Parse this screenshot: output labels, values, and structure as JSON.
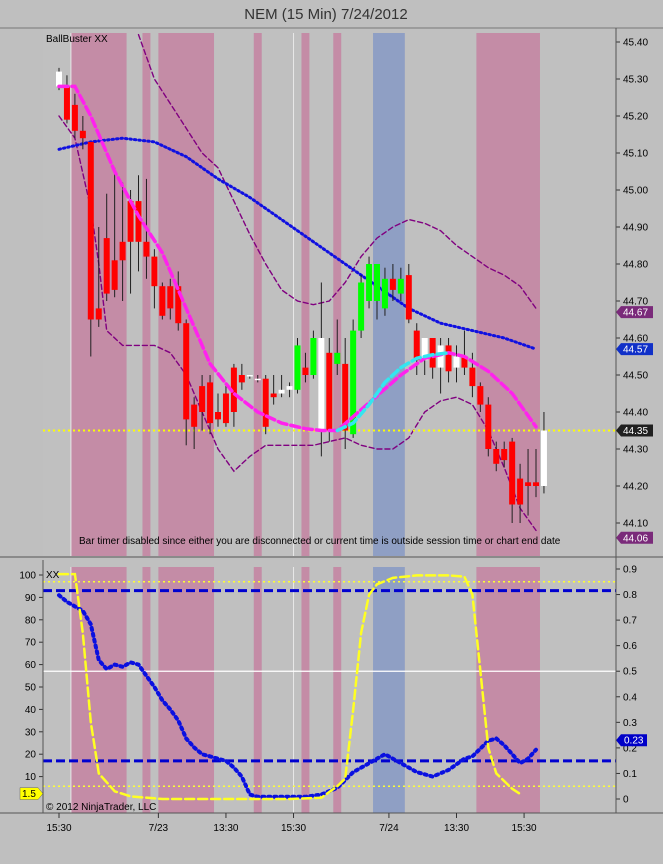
{
  "chart_title": "NEM (15 Min)  7/24/2012",
  "price_panel": {
    "indicator_label": "BallBuster XX",
    "message": "Bar timer disabled since either you are disconnected or current time is outside session time or chart end date",
    "yticks": [
      45.4,
      45.3,
      45.2,
      45.1,
      45.0,
      44.9,
      44.8,
      44.7,
      44.6,
      44.5,
      44.4,
      44.3,
      44.2,
      44.1
    ],
    "ytick_labels": [
      "45.40",
      "45.30",
      "45.20",
      "45.10",
      "45.00",
      "44.90",
      "44.80",
      "44.70",
      "44.60",
      "44.50",
      "44.40",
      "44.30",
      "44.20",
      "44.10"
    ],
    "ylim": [
      44.05,
      45.42
    ],
    "price_markers": [
      {
        "label": "44.67",
        "value": 44.67,
        "color": "#7a2a7a"
      },
      {
        "label": "44.57",
        "value": 44.57,
        "color": "#1030c8"
      },
      {
        "label": "44.35",
        "value": 44.35,
        "color": "#202020"
      },
      {
        "label": "44.06",
        "value": 44.06,
        "color": "#7a2a7a"
      }
    ],
    "yellow_line": 44.35
  },
  "oscillator_panel": {
    "indicator_label": "XX",
    "left_ticks": [
      100,
      90,
      80,
      70,
      60,
      50,
      40,
      30,
      20,
      10
    ],
    "left_tick_labels": [
      "100",
      "90",
      "80",
      "70",
      "60",
      "50",
      "40",
      "30",
      "20",
      "10"
    ],
    "right_ticks": [
      0.9,
      0.8,
      0.7,
      0.6,
      0.5,
      0.4,
      0.3,
      0.2,
      0.1,
      0
    ],
    "right_tick_labels": [
      "0.9",
      "0.8",
      "0.7",
      "0.6",
      "0.5",
      "0.4",
      "0.3",
      "0.2",
      "0.1",
      "0"
    ],
    "left_marker": "1.5",
    "right_marker": "0.23",
    "copyright": "© 2012 NinjaTrader, LLC"
  },
  "x_axis_labels": [
    {
      "label": "15:30",
      "bar": 1
    },
    {
      "label": "7/23",
      "bar": 13.5
    },
    {
      "label": "13:30",
      "bar": 22
    },
    {
      "label": "15:30",
      "bar": 30.5
    },
    {
      "label": "7/24",
      "bar": 42.5
    },
    {
      "label": "13:30",
      "bar": 51
    },
    {
      "label": "15:30",
      "bar": 59.5
    }
  ],
  "chart_data": {
    "type": "candlestick",
    "bars": [
      {
        "o": 45.32,
        "h": 45.33,
        "l": 45.27,
        "c": 45.28
      },
      {
        "o": 45.28,
        "h": 45.31,
        "l": 45.18,
        "c": 45.19
      },
      {
        "o": 45.23,
        "h": 45.26,
        "l": 45.14,
        "c": 45.16
      },
      {
        "o": 45.16,
        "h": 45.2,
        "l": 45.11,
        "c": 45.14
      },
      {
        "o": 45.13,
        "h": 44.95,
        "l": 44.55,
        "c": 44.65
      },
      {
        "o": 44.65,
        "h": 44.9,
        "l": 44.63,
        "c": 44.68
      },
      {
        "o": 44.87,
        "h": 44.99,
        "l": 44.7,
        "c": 44.72
      },
      {
        "o": 44.73,
        "h": 45.06,
        "l": 44.71,
        "c": 44.81
      },
      {
        "o": 44.81,
        "h": 45.02,
        "l": 44.7,
        "c": 44.86
      },
      {
        "o": 44.86,
        "h": 45.0,
        "l": 44.72,
        "c": 44.97
      },
      {
        "o": 44.97,
        "h": 45.04,
        "l": 44.78,
        "c": 44.86
      },
      {
        "o": 44.86,
        "h": 45.03,
        "l": 44.76,
        "c": 44.82
      },
      {
        "o": 44.82,
        "h": 44.84,
        "l": 44.68,
        "c": 44.74
      },
      {
        "o": 44.74,
        "h": 44.75,
        "l": 44.65,
        "c": 44.66
      },
      {
        "o": 44.74,
        "h": 44.76,
        "l": 44.65,
        "c": 44.68
      },
      {
        "o": 44.74,
        "h": 44.78,
        "l": 44.62,
        "c": 44.64
      },
      {
        "o": 44.64,
        "h": 44.65,
        "l": 44.31,
        "c": 44.38
      },
      {
        "o": 44.42,
        "h": 44.44,
        "l": 44.3,
        "c": 44.36
      },
      {
        "o": 44.47,
        "h": 44.5,
        "l": 44.35,
        "c": 44.4
      },
      {
        "o": 44.48,
        "h": 44.5,
        "l": 44.34,
        "c": 44.37
      },
      {
        "o": 44.4,
        "h": 44.45,
        "l": 44.36,
        "c": 44.38
      },
      {
        "o": 44.45,
        "h": 44.48,
        "l": 44.36,
        "c": 44.37
      },
      {
        "o": 44.52,
        "h": 44.53,
        "l": 44.36,
        "c": 44.4
      },
      {
        "o": 44.5,
        "h": 44.53,
        "l": 44.46,
        "c": 44.48
      },
      {
        "o": 44.5,
        "h": 44.5,
        "l": 44.49,
        "c": 44.5
      },
      {
        "o": 44.49,
        "h": 44.5,
        "l": 44.48,
        "c": 44.49
      },
      {
        "o": 44.49,
        "h": 44.5,
        "l": 44.34,
        "c": 44.36
      },
      {
        "o": 44.45,
        "h": 44.5,
        "l": 44.42,
        "c": 44.44
      },
      {
        "o": 44.46,
        "h": 44.5,
        "l": 44.44,
        "c": 44.45
      },
      {
        "o": 44.46,
        "h": 44.48,
        "l": 44.44,
        "c": 44.47
      },
      {
        "o": 44.46,
        "h": 44.6,
        "l": 44.45,
        "c": 44.58
      },
      {
        "o": 44.52,
        "h": 44.56,
        "l": 44.48,
        "c": 44.5
      },
      {
        "o": 44.5,
        "h": 44.62,
        "l": 44.49,
        "c": 44.6
      },
      {
        "o": 44.6,
        "h": 44.75,
        "l": 44.28,
        "c": 44.35
      },
      {
        "o": 44.35,
        "h": 44.6,
        "l": 44.32,
        "c": 44.56
      },
      {
        "o": 44.56,
        "h": 44.65,
        "l": 44.5,
        "c": 44.53
      },
      {
        "o": 44.53,
        "h": 44.6,
        "l": 44.3,
        "c": 44.35
      },
      {
        "o": 44.34,
        "h": 44.65,
        "l": 44.33,
        "c": 44.62
      },
      {
        "o": 44.62,
        "h": 44.77,
        "l": 44.6,
        "c": 44.75
      },
      {
        "o": 44.7,
        "h": 44.82,
        "l": 44.68,
        "c": 44.8
      },
      {
        "o": 44.8,
        "h": 44.8,
        "l": 44.65,
        "c": 44.7
      },
      {
        "o": 44.68,
        "h": 44.79,
        "l": 44.66,
        "c": 44.76
      },
      {
        "o": 44.73,
        "h": 44.8,
        "l": 44.7,
        "c": 44.76
      },
      {
        "o": 44.76,
        "h": 44.79,
        "l": 44.7,
        "c": 44.72
      },
      {
        "o": 44.77,
        "h": 44.8,
        "l": 44.64,
        "c": 44.65
      },
      {
        "o": 44.62,
        "h": 44.64,
        "l": 44.5,
        "c": 44.54
      },
      {
        "o": 44.54,
        "h": 44.6,
        "l": 44.5,
        "c": 44.6
      },
      {
        "o": 44.6,
        "h": 44.6,
        "l": 44.49,
        "c": 44.52
      },
      {
        "o": 44.52,
        "h": 44.6,
        "l": 44.45,
        "c": 44.58
      },
      {
        "o": 44.58,
        "h": 44.6,
        "l": 44.48,
        "c": 44.51
      },
      {
        "o": 44.52,
        "h": 44.58,
        "l": 44.48,
        "c": 44.55
      },
      {
        "o": 44.55,
        "h": 44.62,
        "l": 44.5,
        "c": 44.52
      },
      {
        "o": 44.52,
        "h": 44.56,
        "l": 44.44,
        "c": 44.47
      },
      {
        "o": 44.47,
        "h": 44.48,
        "l": 44.4,
        "c": 44.42
      },
      {
        "o": 44.42,
        "h": 44.44,
        "l": 44.28,
        "c": 44.3
      },
      {
        "o": 44.3,
        "h": 44.32,
        "l": 44.24,
        "c": 44.26
      },
      {
        "o": 44.3,
        "h": 44.32,
        "l": 44.25,
        "c": 44.27
      },
      {
        "o": 44.32,
        "h": 44.33,
        "l": 44.1,
        "c": 44.15
      },
      {
        "o": 44.22,
        "h": 44.26,
        "l": 44.1,
        "c": 44.15
      },
      {
        "o": 44.2,
        "h": 44.3,
        "l": 44.12,
        "c": 44.21
      },
      {
        "o": 44.21,
        "h": 44.3,
        "l": 44.17,
        "c": 44.2
      },
      {
        "o": 44.2,
        "h": 44.4,
        "l": 44.18,
        "c": 44.35
      }
    ],
    "bar_colors": [
      "#ffffff",
      "#ff0000",
      "#ff0000",
      "#ff0000",
      "#ff0000",
      "#ff0000",
      "#ff0000",
      "#ff0000",
      "#ff0000",
      "#ff0000",
      "#ff0000",
      "#ff0000",
      "#ff0000",
      "#ff0000",
      "#ff0000",
      "#ff0000",
      "#ff0000",
      "#ff0000",
      "#ff0000",
      "#ff0000",
      "#ff0000",
      "#ff0000",
      "#ff0000",
      "#ff0000",
      "#ffffff",
      "#ffffff",
      "#ff0000",
      "#ff0000",
      "#ffffff",
      "#ffffff",
      "#00ff00",
      "#ff0000",
      "#00ff00",
      "#ffffff",
      "#ff0000",
      "#00ff00",
      "#ff0000",
      "#00ff00",
      "#00ff00",
      "#00ff00",
      "#00ff00",
      "#00ff00",
      "#ff0000",
      "#00ff00",
      "#ff0000",
      "#ff0000",
      "#ffffff",
      "#ff0000",
      "#ffffff",
      "#ff0000",
      "#ffffff",
      "#ff0000",
      "#ff0000",
      "#ff0000",
      "#ff0000",
      "#ff0000",
      "#ff0000",
      "#ff0000",
      "#ff0000",
      "#ff0000",
      "#ff0000",
      "#ffffff"
    ],
    "session_bands": [
      {
        "start": 2.5,
        "end": 9.5,
        "color": "#c48ca6"
      },
      {
        "start": 11.5,
        "end": 12.5,
        "color": "#c48ca6"
      },
      {
        "start": 13.5,
        "end": 20.5,
        "color": "#c48ca6"
      },
      {
        "start": 25.5,
        "end": 26.5,
        "color": "#c48ca6"
      },
      {
        "start": 31.5,
        "end": 32.5,
        "color": "#c48ca6"
      },
      {
        "start": 35.5,
        "end": 36.5,
        "color": "#c48ca6"
      },
      {
        "start": 40.5,
        "end": 44.5,
        "color": "#8f9fc4"
      },
      {
        "start": 53.5,
        "end": 61.5,
        "color": "#c48ca6"
      }
    ],
    "session_divider_bars": [
      2.5,
      30.5
    ],
    "magenta_ma": [
      [
        1,
        45.28
      ],
      [
        3,
        45.28
      ],
      [
        5,
        45.2
      ],
      [
        8,
        45.05
      ],
      [
        11,
        44.93
      ],
      [
        14,
        44.83
      ],
      [
        17,
        44.68
      ],
      [
        20,
        44.53
      ],
      [
        23,
        44.45
      ],
      [
        26,
        44.4
      ],
      [
        29,
        44.37
      ],
      [
        32,
        44.355
      ],
      [
        34,
        44.35
      ],
      [
        36,
        44.35
      ],
      [
        44,
        44.5
      ],
      [
        47,
        44.545
      ],
      [
        50,
        44.56
      ],
      [
        52,
        44.55
      ],
      [
        55,
        44.51
      ],
      [
        58,
        44.45
      ],
      [
        61,
        44.36
      ]
    ],
    "cyan_ma": [
      [
        36,
        44.35
      ],
      [
        38,
        44.37
      ],
      [
        40,
        44.42
      ],
      [
        42,
        44.48
      ],
      [
        44,
        44.52
      ],
      [
        46,
        44.545
      ],
      [
        48,
        44.555
      ],
      [
        50,
        44.56
      ]
    ],
    "blue_ma": [
      [
        1,
        45.11
      ],
      [
        5,
        45.13
      ],
      [
        9,
        45.14
      ],
      [
        13,
        45.13
      ],
      [
        17,
        45.09
      ],
      [
        21,
        45.03
      ],
      [
        25,
        44.98
      ],
      [
        29,
        44.92
      ],
      [
        33,
        44.86
      ],
      [
        37,
        44.8
      ],
      [
        41,
        44.74
      ],
      [
        45,
        44.68
      ],
      [
        49,
        44.64
      ],
      [
        53,
        44.62
      ],
      [
        57,
        44.6
      ],
      [
        61,
        44.57
      ]
    ],
    "upper_band": [
      [
        11,
        45.42
      ],
      [
        13,
        45.3
      ],
      [
        16,
        45.2
      ],
      [
        19,
        45.1
      ],
      [
        21,
        45.06
      ],
      [
        23,
        44.97
      ],
      [
        25,
        44.88
      ],
      [
        27,
        44.8
      ],
      [
        29,
        44.73
      ],
      [
        31,
        44.7
      ],
      [
        33,
        44.69
      ],
      [
        35,
        44.7
      ],
      [
        37,
        44.75
      ],
      [
        39,
        44.82
      ],
      [
        41,
        44.87
      ],
      [
        43,
        44.9
      ],
      [
        45,
        44.92
      ],
      [
        47,
        44.91
      ],
      [
        49,
        44.89
      ],
      [
        51,
        44.85
      ],
      [
        53,
        44.82
      ],
      [
        55,
        44.79
      ],
      [
        57,
        44.77
      ],
      [
        59,
        44.74
      ],
      [
        61,
        44.68
      ]
    ],
    "lower_band": [
      [
        1,
        45.2
      ],
      [
        3,
        45.14
      ],
      [
        5,
        44.95
      ],
      [
        6,
        44.8
      ],
      [
        7,
        44.62
      ],
      [
        9,
        44.58
      ],
      [
        11,
        44.58
      ],
      [
        13,
        44.58
      ],
      [
        15,
        44.56
      ],
      [
        17,
        44.5
      ],
      [
        19,
        44.4
      ],
      [
        21,
        44.3
      ],
      [
        23,
        44.24
      ],
      [
        25,
        44.28
      ],
      [
        27,
        44.31
      ],
      [
        29,
        44.31
      ],
      [
        31,
        44.31
      ],
      [
        33,
        44.31
      ],
      [
        35,
        44.32
      ],
      [
        37,
        44.33
      ],
      [
        39,
        44.31
      ],
      [
        41,
        44.3
      ],
      [
        43,
        44.3
      ],
      [
        45,
        44.33
      ],
      [
        47,
        44.4
      ],
      [
        49,
        44.43
      ],
      [
        51,
        44.44
      ],
      [
        53,
        44.42
      ],
      [
        55,
        44.35
      ],
      [
        57,
        44.25
      ],
      [
        59,
        44.14
      ],
      [
        61,
        44.08
      ]
    ],
    "osc_yellow": [
      [
        1,
        0.88
      ],
      [
        3,
        0.88
      ],
      [
        4,
        0.65
      ],
      [
        5,
        0.3
      ],
      [
        6,
        0.1
      ],
      [
        8,
        0.03
      ],
      [
        10,
        0.01
      ],
      [
        14,
        0.0
      ],
      [
        18,
        0.0
      ],
      [
        22,
        0.0
      ],
      [
        26,
        0.0
      ],
      [
        30,
        0.0
      ],
      [
        34,
        0.005
      ],
      [
        36,
        0.05
      ],
      [
        37,
        0.08
      ],
      [
        38,
        0.35
      ],
      [
        39,
        0.65
      ],
      [
        40,
        0.8
      ],
      [
        41,
        0.84
      ],
      [
        43,
        0.865
      ],
      [
        46,
        0.875
      ],
      [
        50,
        0.875
      ],
      [
        52,
        0.87
      ],
      [
        53,
        0.8
      ],
      [
        54,
        0.5
      ],
      [
        55,
        0.2
      ],
      [
        56,
        0.1
      ],
      [
        58,
        0.04
      ],
      [
        59,
        0.02
      ]
    ],
    "osc_blue": [
      [
        1,
        91
      ],
      [
        2,
        88
      ],
      [
        3,
        86
      ],
      [
        4,
        84
      ],
      [
        5,
        78
      ],
      [
        6,
        62
      ],
      [
        7,
        58
      ],
      [
        8,
        60
      ],
      [
        9,
        59
      ],
      [
        10,
        61
      ],
      [
        11,
        60
      ],
      [
        12,
        55
      ],
      [
        13,
        50
      ],
      [
        14,
        44
      ],
      [
        15,
        40
      ],
      [
        16,
        35
      ],
      [
        17,
        27
      ],
      [
        18,
        23
      ],
      [
        19,
        20
      ],
      [
        20,
        19
      ],
      [
        21,
        18
      ],
      [
        22,
        17
      ],
      [
        23,
        14
      ],
      [
        24,
        10
      ],
      [
        25,
        2
      ],
      [
        26,
        1
      ],
      [
        28,
        1
      ],
      [
        30,
        1
      ],
      [
        32,
        1
      ],
      [
        34,
        2
      ],
      [
        36,
        5
      ],
      [
        38,
        12
      ],
      [
        40,
        16
      ],
      [
        42,
        20
      ],
      [
        44,
        16
      ],
      [
        46,
        12
      ],
      [
        48,
        10
      ],
      [
        50,
        13
      ],
      [
        52,
        18
      ],
      [
        53,
        19
      ],
      [
        55,
        26
      ],
      [
        56,
        27
      ],
      [
        57,
        24
      ],
      [
        58,
        20
      ],
      [
        59,
        16
      ],
      [
        60,
        18
      ],
      [
        61,
        22
      ]
    ],
    "osc_levels": {
      "upper_blue": 93,
      "lower_blue": 17,
      "upper_yellow": 0.85,
      "white_mid": 0.5,
      "lower_yellow": 0.05
    }
  }
}
